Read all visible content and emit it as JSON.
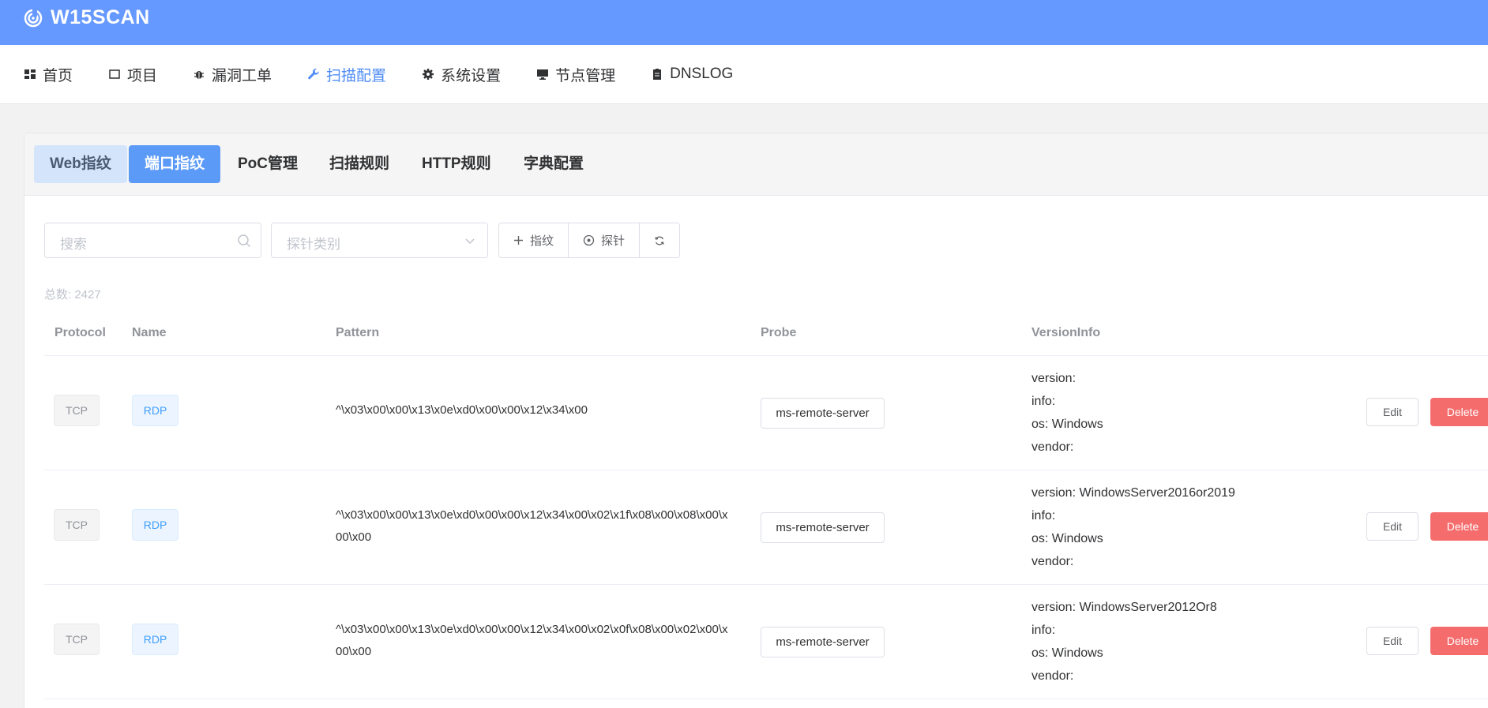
{
  "app": {
    "title": "W15SCAN"
  },
  "nav": {
    "items": [
      {
        "label": "首页",
        "icon": "dashboard-icon"
      },
      {
        "label": "项目",
        "icon": "square-icon"
      },
      {
        "label": "漏洞工单",
        "icon": "bug-icon"
      },
      {
        "label": "扫描配置",
        "icon": "wrench-icon",
        "active": true
      },
      {
        "label": "系统设置",
        "icon": "gear-icon"
      },
      {
        "label": "节点管理",
        "icon": "monitor-icon"
      },
      {
        "label": "DNSLOG",
        "icon": "clipboard-icon"
      }
    ]
  },
  "tabs": [
    "Web指纹",
    "端口指纹",
    "PoC管理",
    "扫描规则",
    "HTTP规则",
    "字典配置"
  ],
  "toolbar": {
    "search_placeholder": "搜索",
    "select_placeholder": "探针类别",
    "add_fingerprint": "指纹",
    "add_probe": "探针"
  },
  "total": "总数: 2427",
  "table": {
    "headers": [
      "Protocol",
      "Name",
      "Pattern",
      "Probe",
      "VersionInfo"
    ],
    "rows": [
      {
        "protocol": "TCP",
        "name": "RDP",
        "pattern": "^\\x03\\x00\\x00\\x13\\x0e\\xd0\\x00\\x00\\x12\\x34\\x00",
        "probe": "ms-remote-server",
        "version": "version:",
        "info": "info:",
        "os": "os: Windows",
        "vendor": "vendor:",
        "edit": "Edit",
        "delete": "Delete"
      },
      {
        "protocol": "TCP",
        "name": "RDP",
        "pattern": "^\\x03\\x00\\x00\\x13\\x0e\\xd0\\x00\\x00\\x12\\x34\\x00\\x02\\x1f\\x08\\x00\\x08\\x00\\x00\\x00",
        "probe": "ms-remote-server",
        "version": "version: WindowsServer2016or2019",
        "info": "info:",
        "os": "os: Windows",
        "vendor": "vendor:",
        "edit": "Edit",
        "delete": "Delete"
      },
      {
        "protocol": "TCP",
        "name": "RDP",
        "pattern": "^\\x03\\x00\\x00\\x13\\x0e\\xd0\\x00\\x00\\x12\\x34\\x00\\x02\\x0f\\x08\\x00\\x02\\x00\\x00\\x00",
        "probe": "ms-remote-server",
        "version": "version: WindowsServer2012Or8",
        "info": "info:",
        "os": "os: Windows",
        "vendor": "vendor:",
        "edit": "Edit",
        "delete": "Delete"
      }
    ]
  },
  "colors": {
    "header_bg": "#6699ff",
    "active_nav": "#4d8bf5",
    "active_tab": "#5b9af7",
    "delete": "#f56c6c"
  }
}
